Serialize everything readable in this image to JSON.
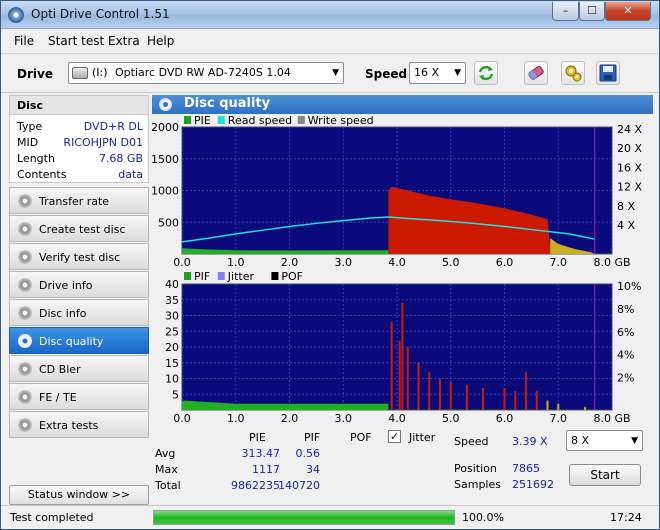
{
  "window": {
    "title": "Opti Drive Control 1.51",
    "min": "–",
    "max": "☐",
    "close": "✕"
  },
  "menu": [
    "File",
    "Start test",
    "Extra",
    "Help"
  ],
  "toolbar": {
    "drive_label": "Drive",
    "drive_letter": "(I:)",
    "drive_value": "Optiarc DVD RW AD-7240S 1.04",
    "speed_label": "Speed",
    "speed_value": "16 X"
  },
  "sidebar": {
    "disc_header": "Disc",
    "info": [
      {
        "key": "Type",
        "value": "DVD+R DL"
      },
      {
        "key": "MID",
        "value": "RICOHJPN D01"
      },
      {
        "key": "Length",
        "value": "7.68 GB"
      },
      {
        "key": "Contents",
        "value": "data"
      }
    ],
    "nav": [
      {
        "label": "Transfer rate",
        "active": false
      },
      {
        "label": "Create test disc",
        "active": false
      },
      {
        "label": "Verify test disc",
        "active": false
      },
      {
        "label": "Drive info",
        "active": false
      },
      {
        "label": "Disc info",
        "active": false
      },
      {
        "label": "Disc quality",
        "active": true
      },
      {
        "label": "CD Bler",
        "active": false
      },
      {
        "label": "FE / TE",
        "active": false
      },
      {
        "label": "Extra tests",
        "active": false
      }
    ],
    "status_window_button": "Status window >>"
  },
  "panel": {
    "title": "Disc quality"
  },
  "chart_data": [
    {
      "type": "area",
      "legend": [
        "PIE",
        "Read speed",
        "Write speed"
      ],
      "legend_colors": [
        "#1fa01f",
        "#20e0e0",
        "#888888"
      ],
      "x_ticks": [
        "0.0",
        "1.0",
        "2.0",
        "3.0",
        "4.0",
        "5.0",
        "6.0",
        "7.0",
        "8.0 GB"
      ],
      "y_ticks_left": [
        "2000",
        "1500",
        "1000",
        "500"
      ],
      "y_ticks_right": [
        "24 X",
        "20 X",
        "16 X",
        "12 X",
        "8 X",
        "4 X"
      ],
      "xlim": [
        0,
        8
      ],
      "ylim_left": [
        0,
        2000
      ],
      "ylim_right": [
        0,
        24
      ],
      "pie_layer0": {
        "x": [
          0,
          0.5,
          1.0,
          1.5,
          2.0,
          2.5,
          3.0,
          3.5,
          3.84
        ],
        "y": [
          90,
          70,
          60,
          55,
          55,
          55,
          60,
          60,
          60
        ]
      },
      "pie_layer1": {
        "x": [
          3.84,
          3.9,
          4.2,
          4.6,
          5.0,
          5.5,
          6.0,
          6.5,
          6.8,
          6.85
        ],
        "y": [
          1000,
          1060,
          1000,
          920,
          860,
          800,
          720,
          620,
          550,
          80
        ]
      },
      "pie_layer1_tail": {
        "x": [
          6.85,
          7.0,
          7.3,
          7.6,
          7.68
        ],
        "y": [
          250,
          160,
          80,
          30,
          0
        ]
      },
      "read_speed": {
        "x": [
          0,
          0.5,
          1.0,
          1.5,
          2.0,
          2.5,
          3.0,
          3.5,
          3.84,
          4.2,
          4.8,
          5.4,
          6.0,
          6.6,
          7.2,
          7.68
        ],
        "y": [
          2.3,
          3.0,
          3.8,
          4.5,
          5.2,
          5.8,
          6.3,
          6.8,
          7.0,
          6.7,
          6.3,
          5.8,
          5.2,
          4.5,
          3.8,
          2.8
        ]
      }
    },
    {
      "type": "area",
      "legend": [
        "PIF",
        "Jitter",
        "POF"
      ],
      "legend_colors": [
        "#1fa01f",
        "#8080ff",
        "#000000"
      ],
      "x_ticks": [
        "0.0",
        "1.0",
        "2.0",
        "3.0",
        "4.0",
        "5.0",
        "6.0",
        "7.0",
        "8.0 GB"
      ],
      "y_ticks_left": [
        "40",
        "35",
        "30",
        "25",
        "20",
        "15",
        "10",
        "5"
      ],
      "y_ticks_right": [
        "10%",
        "8%",
        "6%",
        "4%",
        "2%"
      ],
      "xlim": [
        0,
        8
      ],
      "ylim_left": [
        0,
        40
      ],
      "ylim_right": [
        0,
        10
      ],
      "pif_layer0": {
        "x": [
          0,
          1.0,
          2.0,
          3.0,
          3.84
        ],
        "y": [
          3,
          2,
          2,
          2,
          2
        ]
      },
      "pif_spikes": {
        "x": [
          3.9,
          4.05,
          4.1,
          4.2,
          4.4,
          4.6,
          4.8,
          5.0,
          5.3,
          5.6,
          6.0,
          6.2,
          6.4,
          6.6,
          6.8,
          7.0,
          7.5
        ],
        "y": [
          28,
          22,
          34,
          20,
          15,
          12,
          10,
          9,
          8,
          7,
          7,
          6,
          12,
          6,
          3,
          2,
          1
        ]
      }
    }
  ],
  "stats": {
    "col_pie": "PIE",
    "col_pif": "PIF",
    "col_pof": "POF",
    "jitter_label": "Jitter",
    "jitter_checked": "✓",
    "rows": [
      {
        "label": "Avg",
        "pie": "313.47",
        "pif": "0.56"
      },
      {
        "label": "Max",
        "pie": "1117",
        "pif": "34"
      },
      {
        "label": "Total",
        "pie": "9862235",
        "pif": "140720"
      }
    ],
    "speed_label": "Speed",
    "speed_value": "3.39 X",
    "speed_select": "8 X",
    "position_label": "Position",
    "position_value": "7865",
    "samples_label": "Samples",
    "samples_value": "251692",
    "start_button": "Start"
  },
  "status": {
    "text": "Test completed",
    "progress_percent": 100,
    "progress_text": "100.0%",
    "time": "17:24"
  }
}
